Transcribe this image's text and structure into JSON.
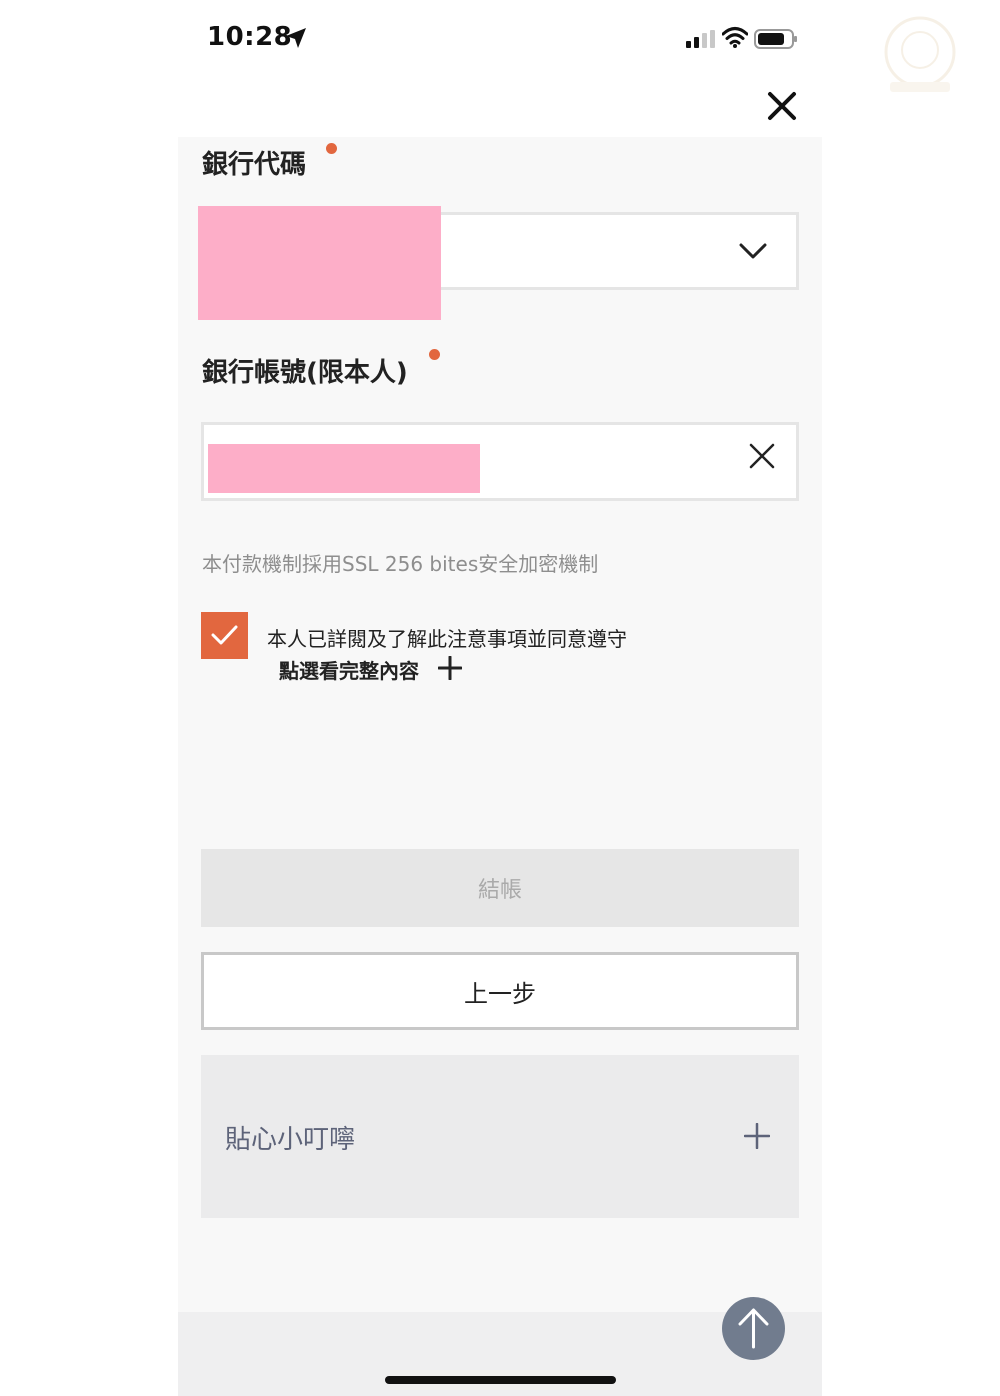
{
  "status_bar": {
    "time": "10:28"
  },
  "form": {
    "bank_code_label": "銀行代碼",
    "bank_account_label": "銀行帳號(限本人)",
    "ssl_note": "本付款機制採用SSL 256 bites安全加密機制",
    "agreement_text": "本人已詳閱及了解此注意事項並同意遵守",
    "agreement_checked": true,
    "view_full_label": "點選看完整內容"
  },
  "buttons": {
    "checkout_label": "結帳",
    "back_label": "上一步"
  },
  "tips": {
    "title": "貼心小叮嚀"
  },
  "colors": {
    "accent": "#e2673f",
    "redaction": "#fdaec8",
    "scroll_button": "#717c8e",
    "tips_text": "#5d6379"
  },
  "icons": {
    "close": "close-icon",
    "chevron": "chevron-down-icon",
    "clear": "clear-icon",
    "check": "check-icon",
    "plus": "plus-icon",
    "scroll_top": "arrow-up-icon"
  }
}
